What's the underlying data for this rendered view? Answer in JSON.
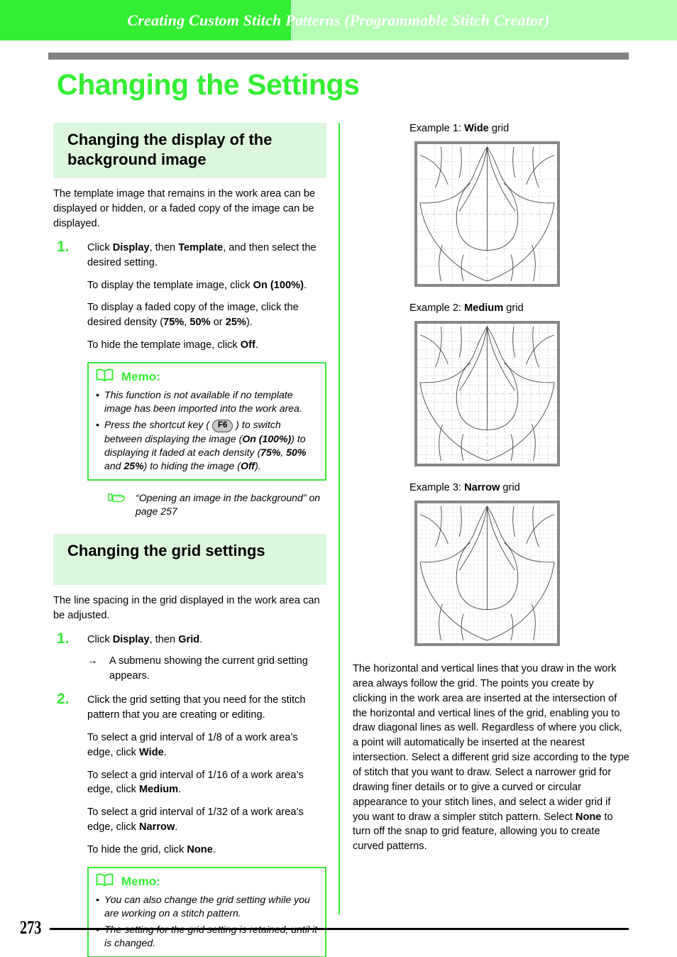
{
  "header": {
    "running_title": "Creating Custom Stitch Patterns (Programmable Stitch Creator)",
    "band_color_left": "#33ee33",
    "band_color_right": "#b5ffb5",
    "rule_color": "#828282"
  },
  "page_title": "Changing the Settings",
  "page_number": "273",
  "left_column": {
    "section1": {
      "heading": "Changing the display of the background image",
      "intro": "The template image that remains in the work area can be displayed or hidden, or a faded copy of the image can be displayed.",
      "step1": {
        "num": "1.",
        "line1_a": "Click ",
        "line1_b": "Display",
        "line1_c": ", then ",
        "line1_d": "Template",
        "line1_e": ", and then select the desired setting.",
        "line2_a": "To display the template image, click ",
        "line2_b": "On (100%)",
        "line2_c": ".",
        "line3_a": "To display a faded copy of the image, click the desired density (",
        "line3_b": "75%",
        "line3_c": ", ",
        "line3_d": "50%",
        "line3_e": " or ",
        "line3_f": "25%",
        "line3_g": ").",
        "line4_a": "To hide the template image, click ",
        "line4_b": "Off",
        "line4_c": "."
      },
      "memo": {
        "title": "Memo:",
        "item1": "This function is not available if no template image has been imported into the work area.",
        "item2_a": "Press the shortcut key ( ",
        "item2_key": "F6",
        "item2_b": " ) to switch between displaying the image (",
        "item2_c": "On (100%)",
        "item2_d": ") to displaying it faded at each density (",
        "item2_e": "75%",
        "item2_f": ", ",
        "item2_g": "50%",
        "item2_h": " and ",
        "item2_i": "25%",
        "item2_j": ") to hiding the image (",
        "item2_k": "Off",
        "item2_l": ")."
      },
      "reference": "“Opening an image in the background” on page 257"
    },
    "section2": {
      "heading": "Changing the grid settings",
      "intro": "The line spacing in the grid displayed in the work area can be adjusted.",
      "step1": {
        "num": "1.",
        "line1_a": "Click ",
        "line1_b": "Display",
        "line1_c": ", then ",
        "line1_d": "Grid",
        "line1_e": ".",
        "arrow": "→",
        "sub": "A submenu showing the current grid setting appears."
      },
      "step2": {
        "num": "2.",
        "line1": "Click the grid setting that you need for the stitch pattern that you are creating or editing.",
        "line2_a": "To select a grid interval of 1/8 of a work area’s edge, click ",
        "line2_b": "Wide",
        "line2_c": ".",
        "line3_a": "To select a grid interval of 1/16 of a work area’s edge, click ",
        "line3_b": "Medium",
        "line3_c": ".",
        "line4_a": "To select a grid interval of 1/32 of a work area’s edge, click ",
        "line4_b": "Narrow",
        "line4_c": ".",
        "line5_a": "To hide the grid, click ",
        "line5_b": "None",
        "line5_c": "."
      },
      "memo": {
        "title": "Memo:",
        "item1": "You can also change the grid setting while you are working on a stitch pattern.",
        "item2": "The setting for the grid setting is retained, until it is changed."
      }
    }
  },
  "right_column": {
    "examples": [
      {
        "prefix": "Example 1: ",
        "name": "Wide",
        "suffix": " grid",
        "divisions": 8
      },
      {
        "prefix": "Example 2: ",
        "name": "Medium",
        "suffix": " grid",
        "divisions": 16
      },
      {
        "prefix": "Example 3: ",
        "name": "Narrow",
        "suffix": " grid",
        "divisions": 32
      }
    ],
    "body_a": "The horizontal and vertical lines that you draw in the work area always follow the grid. The points you create by clicking in the work area are inserted at the intersection of the horizontal and vertical lines of the grid, enabling you to draw diagonal lines as well. Regardless of where you click, a point will automatically be inserted at the nearest intersection. Select a different grid size according to the type of stitch that you want to draw. Select a narrower grid for drawing finer details or to give a curved or circular appearance to your stitch lines, and select a wider grid if you want to draw a simpler stitch pattern. Select ",
    "body_bold": "None",
    "body_b": " to turn off the snap to grid feature, allowing you to create curved patterns."
  },
  "colors": {
    "accent_green": "#33ee33",
    "section_bg": "#ddf7dd",
    "figure_border": "#878787",
    "grid_line": "#b9b9b9"
  }
}
